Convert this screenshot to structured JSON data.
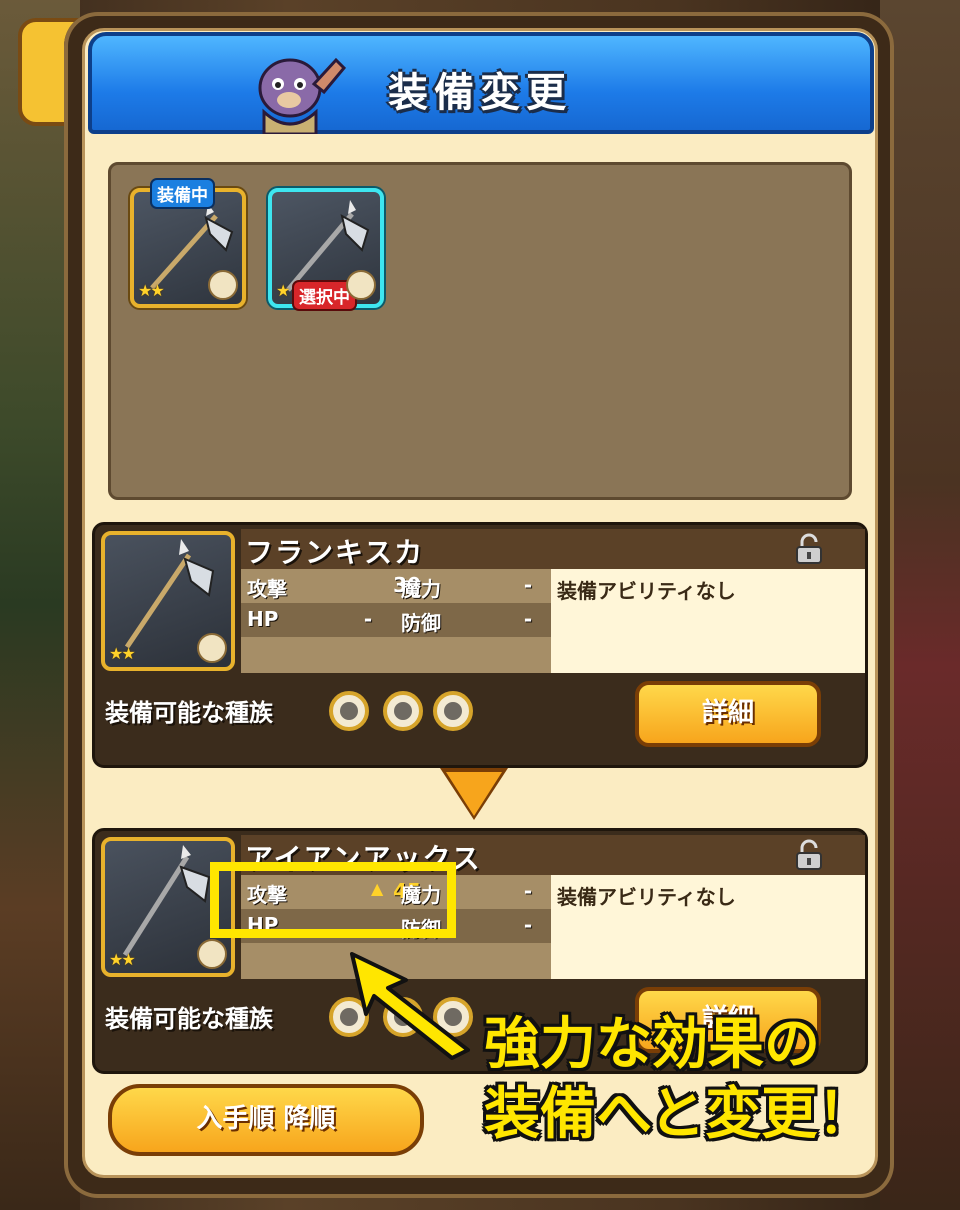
{
  "header": {
    "title": "装備変更"
  },
  "inventory": {
    "slots": [
      {
        "badge": "装備中",
        "stars": "★★"
      },
      {
        "badge": "選択中",
        "stars": "★"
      }
    ]
  },
  "current_item": {
    "name": "フランキスカ",
    "stars": "★★",
    "stats": {
      "attack_label": "攻撃",
      "attack_value": "30",
      "magic_label": "魔力",
      "magic_value": "-",
      "hp_label": "HP",
      "hp_value": "-",
      "defense_label": "防御",
      "defense_value": "-"
    },
    "ability": "装備アビリティなし",
    "race_label": "装備可能な種族",
    "detail_button": "詳細"
  },
  "new_item": {
    "name": "アイアンアックス",
    "stars": "★★",
    "stats": {
      "attack_label": "攻撃",
      "attack_value": "45",
      "magic_label": "魔力",
      "magic_value": "-",
      "hp_label": "HP",
      "hp_value": "",
      "defense_label": "防御",
      "defense_value": "-"
    },
    "ability": "装備アビリティなし",
    "race_label": "装備可能な種族",
    "detail_button": "詳細"
  },
  "sort_button": "入手順 降順",
  "caption": {
    "line1": "強力な効果の",
    "line2": "装備へと変更！"
  },
  "colors": {
    "header": "#1d7be8",
    "accent": "#f7a51c",
    "highlight": "#ffe600"
  }
}
